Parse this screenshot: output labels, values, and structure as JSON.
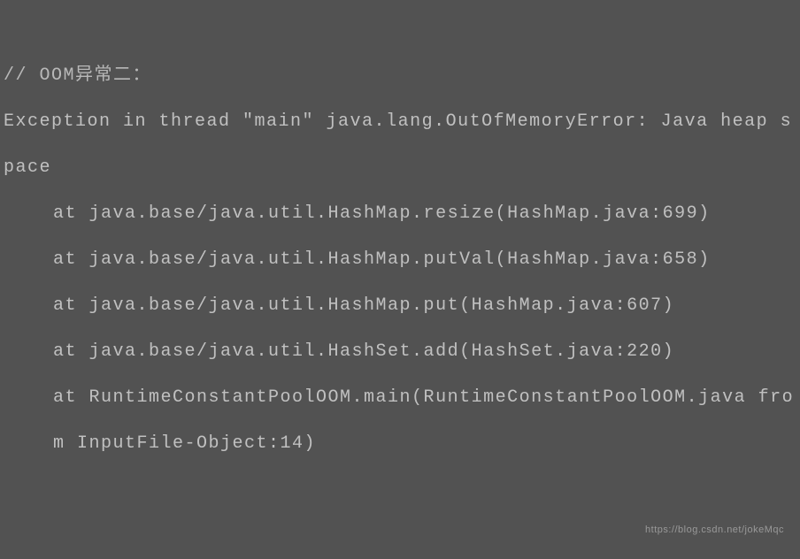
{
  "code": {
    "comment_line": "// OOM异常二：",
    "exception_line": "Exception in thread \"main\" java.lang.OutOfMemoryError: Java heap space",
    "stack_trace": [
      "at java.base/java.util.HashMap.resize(HashMap.java:699)",
      "at java.base/java.util.HashMap.putVal(HashMap.java:658)",
      "at java.base/java.util.HashMap.put(HashMap.java:607)",
      "at java.base/java.util.HashSet.add(HashSet.java:220)",
      "at RuntimeConstantPoolOOM.main(RuntimeConstantPoolOOM.java from InputFile-Object:14)"
    ]
  },
  "watermark": "https://blog.csdn.net/jokeMqc"
}
